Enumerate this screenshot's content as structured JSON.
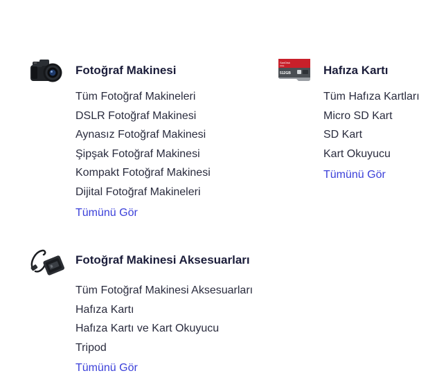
{
  "sections": [
    {
      "title": "Fotoğraf Makinesi",
      "icon": "camera-icon",
      "links": [
        "Tüm Fotoğraf Makineleri",
        "DSLR Fotoğraf Makinesi",
        "Aynasız Fotoğraf Makinesi",
        "Şipşak Fotoğraf Makinesi",
        "Kompakt Fotoğraf Makinesi",
        "Dijital Fotoğraf Makineleri"
      ],
      "see_all": "Tümünü Gör"
    },
    {
      "title": "Hafıza Kartı",
      "icon": "memory-card-icon",
      "links": [
        "Tüm Hafıza Kartları",
        "Micro SD Kart",
        "SD Kart",
        "Kart Okuyucu"
      ],
      "see_all": "Tümünü Gör",
      "card_brand": "SanDisk",
      "card_line": "Ultra",
      "card_capacity": "512GB"
    },
    {
      "title": "Fotoğraf Makinesi Aksesuarları",
      "icon": "camera-charger-icon",
      "links": [
        "Tüm Fotoğraf Makinesi Aksesuarları",
        "Hafıza Kartı",
        "Hafıza Kartı ve Kart Okuyucu",
        "Tripod"
      ],
      "see_all": "Tümünü Gör"
    }
  ],
  "colors": {
    "title": "#1b1d3a",
    "link": "#2a2c3e",
    "see_all": "#3a3fd9",
    "card_red": "#c8202a"
  }
}
